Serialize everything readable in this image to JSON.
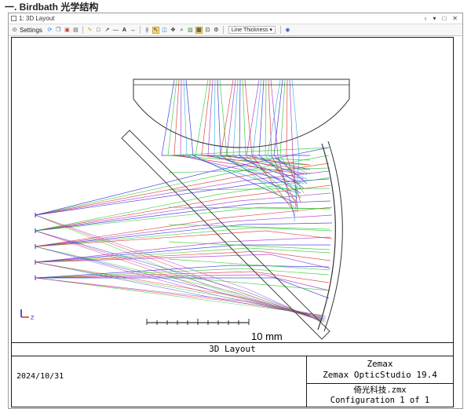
{
  "doc_heading": "一. Birdbath 光学结构",
  "window": {
    "title": "1: 3D Layout",
    "controls": [
      "‹",
      "▾",
      "□",
      "✕"
    ]
  },
  "toolbar": {
    "settings_label": "Settings",
    "line_thickness_label": "Line Thickness",
    "icons": [
      "refresh-icon",
      "copy-icon",
      "save-icon",
      "print-icon",
      "pencil-icon",
      "rectangle-icon",
      "arrow-icon",
      "line-icon",
      "text-icon",
      "dimension-icon",
      "lens-icon",
      "pointer-icon",
      "layers-icon",
      "pan-icon",
      "zoom-icon",
      "image-icon",
      "stack-icon",
      "fit-icon",
      "settings-cog-icon",
      "globe-icon"
    ]
  },
  "plot": {
    "scale_label": "10 mm",
    "axis_label": "Z",
    "ray_colors": [
      "#1f1fd9",
      "#23c523",
      "#e02626",
      "#9d23c9",
      "#2aa9e0"
    ]
  },
  "info_block": {
    "title": "3D Layout",
    "date": "2024/10/31",
    "company": "Zemax",
    "product": "Zemax OpticStudio 19.4",
    "file": "倚光科技.zmx",
    "configuration": "Configuration 1 of 1"
  }
}
